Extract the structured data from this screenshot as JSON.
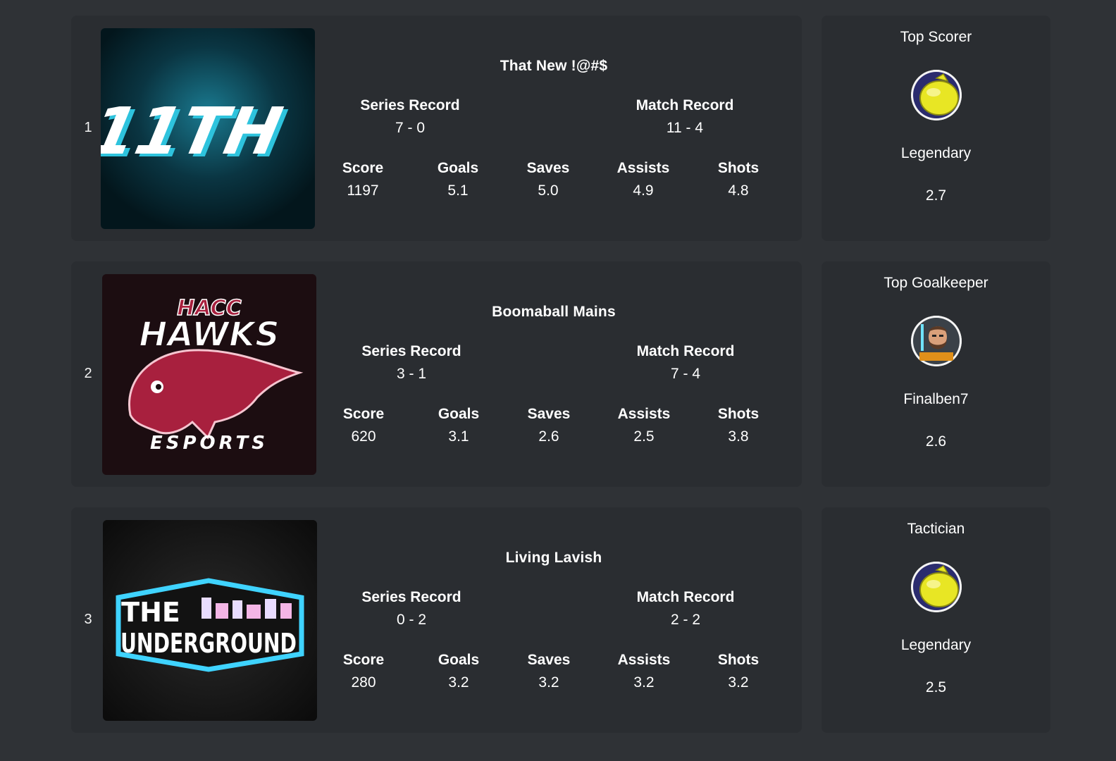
{
  "labels": {
    "series_record": "Series Record",
    "match_record": "Match Record",
    "score": "Score",
    "goals": "Goals",
    "saves": "Saves",
    "assists": "Assists",
    "shots": "Shots"
  },
  "teams": [
    {
      "rank": "1",
      "logo": "11th-team-logo",
      "logo_text": "11TH",
      "name": "That New !@#$",
      "series_record": "7 - 0",
      "match_record": "11 - 4",
      "score": "1197",
      "goals": "5.1",
      "saves": "5.0",
      "assists": "4.9",
      "shots": "4.8",
      "award": {
        "title": "Top Scorer",
        "player": "Legendary",
        "value": "2.7",
        "avatar": "lemon-avatar"
      }
    },
    {
      "rank": "2",
      "logo": "hacc-hawks-logo",
      "logo_text_top": "HACC",
      "logo_text_mid": "HAWKS",
      "logo_text_bottom": "ESPORTS",
      "name": "Boomaball Mains",
      "series_record": "3 - 1",
      "match_record": "7 - 4",
      "score": "620",
      "goals": "3.1",
      "saves": "2.6",
      "assists": "2.5",
      "shots": "3.8",
      "award": {
        "title": "Top Goalkeeper",
        "player": "Finalben7",
        "value": "2.6",
        "avatar": "bearded-player-avatar"
      }
    },
    {
      "rank": "3",
      "logo": "the-underground-logo",
      "logo_text_top": "THE",
      "logo_text_bottom": "UNDERGROUND",
      "name": "Living Lavish",
      "series_record": "0 - 2",
      "match_record": "2 - 2",
      "score": "280",
      "goals": "3.2",
      "saves": "3.2",
      "assists": "3.2",
      "shots": "3.2",
      "award": {
        "title": "Tactician",
        "player": "Legendary",
        "value": "2.5",
        "avatar": "lemon-avatar"
      }
    }
  ]
}
